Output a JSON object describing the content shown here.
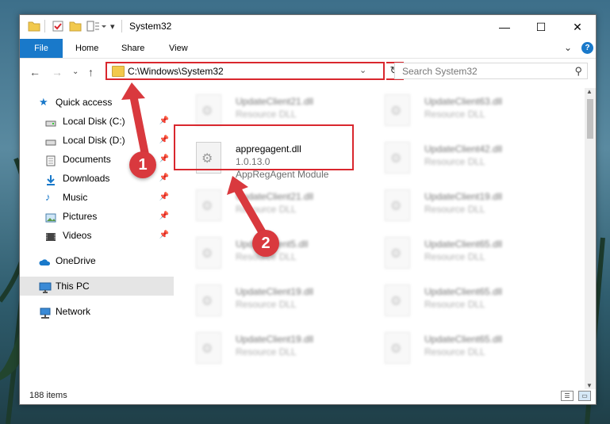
{
  "window": {
    "title": "System32",
    "minimize": "—",
    "maximize": "☐",
    "close": "✕"
  },
  "ribbon": {
    "tabs": [
      "File",
      "Home",
      "Share",
      "View"
    ],
    "expand_chevron": "⌄",
    "help": "?"
  },
  "address": {
    "path": "C:\\Windows\\System32",
    "dropdown_chevron": "⌄",
    "refresh": "↻"
  },
  "nav_buttons": {
    "back": "←",
    "forward": "→",
    "recent": "⌄",
    "up": "↑"
  },
  "search": {
    "placeholder": "Search System32",
    "icon": "⚲"
  },
  "sidebar": {
    "items": [
      {
        "label": "Quick access",
        "icon": "star-icon",
        "pinned": false
      },
      {
        "label": "Local Disk (C:)",
        "icon": "drive-icon",
        "pinned": true
      },
      {
        "label": "Local Disk (D:)",
        "icon": "drive-icon",
        "pinned": true
      },
      {
        "label": "Documents",
        "icon": "documents-icon",
        "pinned": true
      },
      {
        "label": "Downloads",
        "icon": "downloads-icon",
        "pinned": true
      },
      {
        "label": "Music",
        "icon": "music-icon",
        "pinned": true
      },
      {
        "label": "Pictures",
        "icon": "pictures-icon",
        "pinned": true
      },
      {
        "label": "Videos",
        "icon": "videos-icon",
        "pinned": true
      },
      {
        "label": "OneDrive",
        "icon": "cloud-icon",
        "pinned": false
      },
      {
        "label": "This PC",
        "icon": "pc-icon",
        "pinned": false,
        "selected": true
      },
      {
        "label": "Network",
        "icon": "network-icon",
        "pinned": false
      }
    ],
    "pin_glyph": "📌"
  },
  "files": {
    "featured": {
      "name": "appregagent.dll",
      "version": "1.0.13.0",
      "description": "AppRegAgent Module"
    },
    "left_column": [
      {
        "name": "UpdateClient21.dll",
        "type": "Resource DLL"
      },
      {
        "name": "UpdateClient21.dll",
        "type": "Resource DLL"
      },
      {
        "name": "UpdateClient5.dll",
        "type": "Resource DLL"
      },
      {
        "name": "UpdateClient19.dll",
        "type": "Resource DLL"
      },
      {
        "name": "UpdateClient19.dll",
        "type": "Resource DLL"
      }
    ],
    "right_column": [
      {
        "name": "UpdateClient63.dll",
        "type": "Resource DLL"
      },
      {
        "name": "UpdateClient42.dll",
        "type": "Resource DLL"
      },
      {
        "name": "UpdateClient19.dll",
        "type": "Resource DLL"
      },
      {
        "name": "UpdateClient65.dll",
        "type": "Resource DLL"
      },
      {
        "name": "UpdateClient65.dll",
        "type": "Resource DLL"
      },
      {
        "name": "UpdateClient65.dll",
        "type": "Resource DLL"
      }
    ]
  },
  "status": {
    "count": "188 items"
  },
  "callouts": [
    "1",
    "2"
  ],
  "colors": {
    "accent_blue": "#1979ca",
    "highlight_red": "#d9272e",
    "callout_red": "#d9393e",
    "folder_yellow": "#f2c94c"
  }
}
